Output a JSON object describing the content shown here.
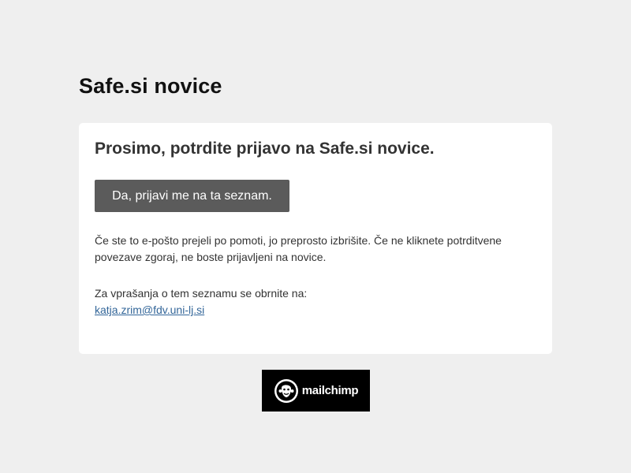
{
  "header": {
    "title": "Safe.si novice"
  },
  "card": {
    "heading": "Prosimo, potrdite prijavo na Safe.si novice.",
    "confirm_label": "Da, prijavi me na ta seznam.",
    "disclaimer": "Če ste to e-pošto prejeli po pomoti, jo preprosto izbrišite. Če ne kliknete potrditvene povezave zgoraj, ne boste prijavljeni na novice.",
    "contact_prefix": "Za vprašanja o tem seznamu se obrnite na:",
    "contact_email": "katja.zrim@fdv.uni-lj.si"
  },
  "footer": {
    "badge_label": "mailchimp",
    "badge_icon": "mailchimp-freddie-icon"
  },
  "colors": {
    "background": "#efefef",
    "card": "#ffffff",
    "button": "#5b5b5b",
    "link": "#336699",
    "badge": "#000000"
  }
}
